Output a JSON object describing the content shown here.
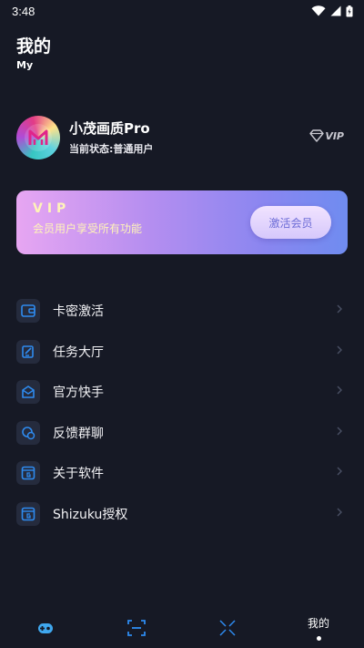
{
  "status_bar": {
    "time": "3:48"
  },
  "header": {
    "title": "我的",
    "subtitle": "My"
  },
  "profile": {
    "name": "小茂画质Pro",
    "status": "当前状态:普通用户",
    "badge": "VIP"
  },
  "vip_card": {
    "title": "VIP",
    "description": "会员用户享受所有功能",
    "button_label": "激活会员"
  },
  "menu": {
    "items": [
      {
        "label": "卡密激活",
        "icon": "wallet-icon"
      },
      {
        "label": "任务大厅",
        "icon": "task-icon"
      },
      {
        "label": "官方快手",
        "icon": "mail-icon"
      },
      {
        "label": "反馈群聊",
        "icon": "chat-icon"
      },
      {
        "label": "关于软件",
        "icon": "app-g-icon"
      },
      {
        "label": "Shizuku授权",
        "icon": "app-g-icon"
      }
    ]
  },
  "bottom_nav": {
    "items": [
      {
        "icon": "gamepad-icon"
      },
      {
        "icon": "scan-icon"
      },
      {
        "icon": "tools-icon"
      },
      {
        "label": "我的",
        "active": true
      }
    ]
  },
  "colors": {
    "background": "#161925",
    "accent": "#2e8bf0",
    "vip_gold": "#fff4b8"
  }
}
